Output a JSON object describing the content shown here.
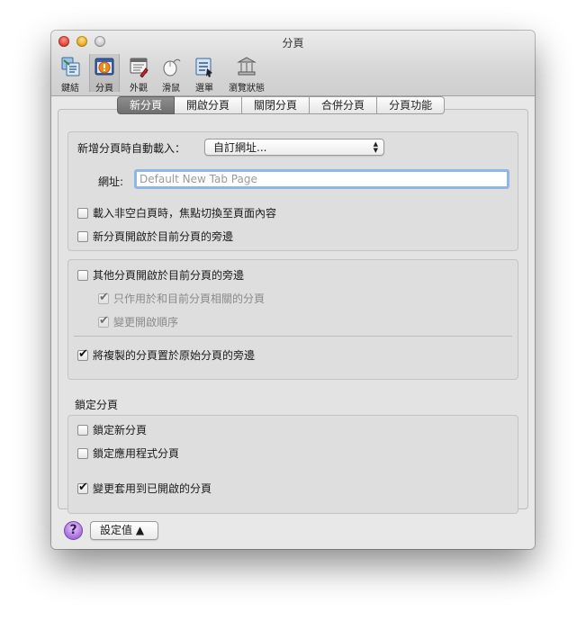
{
  "window": {
    "title": "分頁"
  },
  "toolbar": [
    {
      "label": "鍵結",
      "icon": "keyboard-icon"
    },
    {
      "label": "分頁",
      "icon": "tabs-icon"
    },
    {
      "label": "外觀",
      "icon": "appearance-icon"
    },
    {
      "label": "滑鼠",
      "icon": "mouse-icon"
    },
    {
      "label": "選單",
      "icon": "menu-icon"
    },
    {
      "label": "瀏覽狀態",
      "icon": "browsing-state-icon"
    }
  ],
  "tabs": [
    "新分頁",
    "開啟分頁",
    "關閉分頁",
    "合併分頁",
    "分頁功能"
  ],
  "new_tab": {
    "autoload_label": "新增分頁時自動載入：",
    "autoload_value": "自訂網址...",
    "url_label": "網址:",
    "url_placeholder": "Default New Tab Page",
    "focus_content": {
      "label": "載入非空白頁時，焦點切換至頁面內容",
      "checked": false
    },
    "open_next": {
      "label": "新分頁開啟於目前分頁的旁邊",
      "checked": false
    }
  },
  "other_tabs": {
    "open_next": {
      "label": "其他分頁開啟於目前分頁的旁邊",
      "checked": false
    },
    "related_only": {
      "label": "只作用於和目前分頁相關的分頁",
      "checked": true
    },
    "change_order": {
      "label": "變更開啟順序",
      "checked": true
    },
    "duplicate_next": {
      "label": "將複製的分頁置於原始分頁的旁邊",
      "checked": true
    }
  },
  "lock": {
    "title": "鎖定分頁",
    "lock_new": {
      "label": "鎖定新分頁",
      "checked": false
    },
    "lock_apps": {
      "label": "鎖定應用程式分頁",
      "checked": false
    },
    "apply_open": {
      "label": "變更套用到已開啟的分頁",
      "checked": true
    }
  },
  "footer": {
    "help_label": "?",
    "settings_label": "設定值 ▲"
  }
}
